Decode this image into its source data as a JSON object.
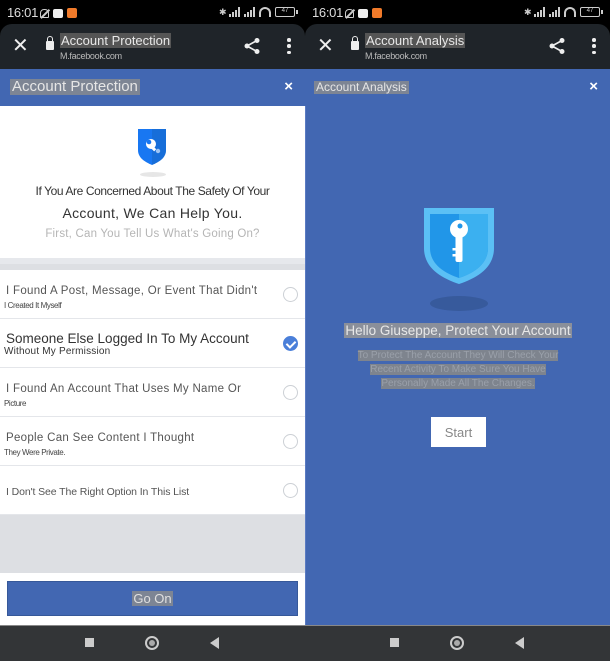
{
  "status_bar": {
    "time": "16:01",
    "battery": "47"
  },
  "left": {
    "browser": {
      "title": "Account Protection",
      "url": "M.facebook.com"
    },
    "header": {
      "title": "Account Protection",
      "close": "×"
    },
    "intro": {
      "line1": "If You Are Concerned About The Safety Of Your",
      "line2": "Account, We Can Help You.",
      "line3": "First, Can You Tell Us What's Going On?"
    },
    "options": [
      {
        "main": "I Found A Post, Message, Or Event That Didn't",
        "sub": "I Created It Myself",
        "selected": false
      },
      {
        "main": "Someone Else Logged In To My Account",
        "sub": "Without My Permission",
        "selected": true
      },
      {
        "main": "I Found An Account That Uses My Name Or",
        "sub": "Picture",
        "selected": false
      },
      {
        "main": "People Can See Content I Thought",
        "sub": "They Were Private.",
        "selected": false
      },
      {
        "main": "I Don't See The Right Option In This List",
        "sub": "",
        "selected": false
      }
    ],
    "go_button": "Go On"
  },
  "right": {
    "browser": {
      "title": "Account Analysis",
      "url": "M.facebook.com"
    },
    "header": {
      "title": "Account Analysis",
      "close": "×"
    },
    "hello": "Hello Giuseppe, Protect Your Account",
    "description": [
      "To Protect The Account They Will Check Your",
      "Recent Activity To Make Sure You Have",
      "Personally Made All The Changes."
    ],
    "start_button": "Start"
  },
  "colors": {
    "facebook_blue": "#4267b2",
    "checked_radio": "#4a7fd9",
    "toolbar_dark": "#1f2429"
  }
}
